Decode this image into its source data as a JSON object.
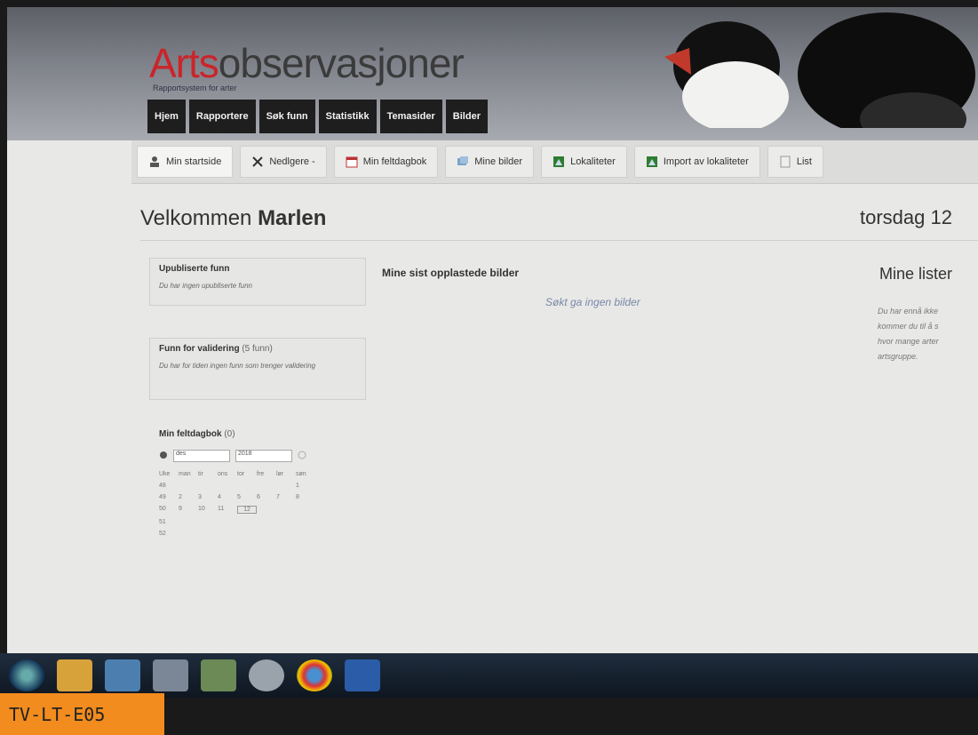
{
  "header": {
    "logo_part1": "Arts",
    "logo_part2": "observasjoner",
    "tagline": "Rapportsystem for arter",
    "nav": [
      "Hjem",
      "Rapportere",
      "Søk funn",
      "Statistikk",
      "Temasider",
      "Bilder"
    ]
  },
  "tabs": [
    "Min startside",
    "Nedlgere -",
    "Min feltdagbok",
    "Mine bilder",
    "Lokaliteter",
    "Import av lokaliteter",
    "List"
  ],
  "page": {
    "welcome": "Velkommen",
    "user": "Marlen",
    "date": "torsdag 12"
  },
  "left": {
    "unpublished": {
      "title": "Upubliserte funn",
      "text": "Du har ingen upubliserte funn"
    },
    "validation": {
      "title": "Funn for validering",
      "count": "(5 funn)",
      "text": "Du har for tiden ingen funn som trenger validering"
    },
    "diary": {
      "title": "Min feltdagbok",
      "count": "(0)",
      "month": "des",
      "year": "2018",
      "weekdays": [
        "Uke",
        "man",
        "tir",
        "ons",
        "tor",
        "fre",
        "lør",
        "søn"
      ],
      "weeks": [
        [
          "48",
          "",
          "",
          "",
          "",
          "",
          "",
          "1"
        ],
        [
          "49",
          "2",
          "3",
          "4",
          "5",
          "6",
          "7",
          "8"
        ],
        [
          "50",
          "9",
          "10",
          "11",
          "12",
          "",
          "",
          ""
        ],
        [
          "51",
          "",
          "",
          "",
          "",
          "",
          "",
          ""
        ],
        [
          "52",
          "",
          "",
          "",
          "",
          "",
          "",
          ""
        ]
      ],
      "today": "12"
    }
  },
  "center": {
    "title": "Mine sist opplastede bilder",
    "empty": "Søkt ga ingen bilder"
  },
  "right": {
    "title": "Mine lister",
    "lines": [
      "Du har ennå ikke",
      "kommer du til å s",
      "hvor mange arter",
      "artsgruppe."
    ]
  },
  "sticker": "TV-LT-E05",
  "colors": {
    "accent": "#c9252b",
    "nav_bg": "#1e1e1e",
    "sticker": "#f28c1e"
  }
}
